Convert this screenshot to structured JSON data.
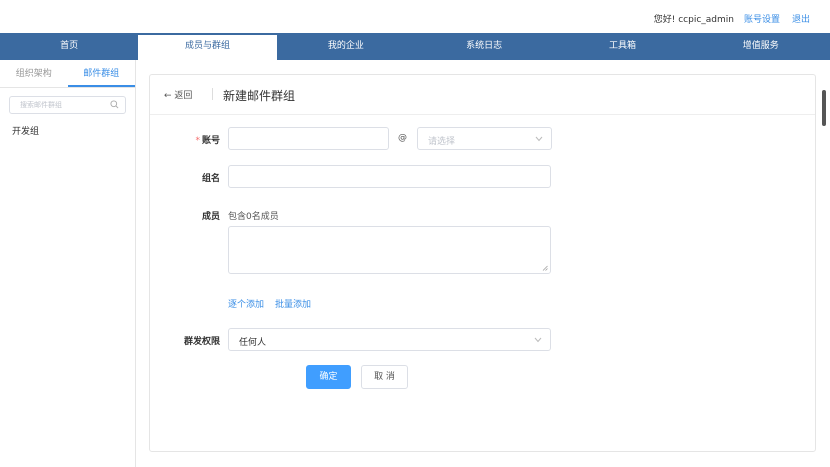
{
  "header": {
    "greeting": "您好! ccpic_admin",
    "account_settings": "账号设置",
    "logout": "退出"
  },
  "nav": {
    "items": [
      {
        "label": "首页"
      },
      {
        "label": "成员与群组"
      },
      {
        "label": "我的企业"
      },
      {
        "label": "系统日志"
      },
      {
        "label": "工具箱"
      },
      {
        "label": "增值服务"
      }
    ],
    "active_index": 1
  },
  "sidebar": {
    "tabs": [
      {
        "label": "组织架构"
      },
      {
        "label": "邮件群组"
      }
    ],
    "active_tab": 1,
    "search_placeholder": "搜索邮件群组",
    "groups": [
      {
        "label": "开发组"
      }
    ]
  },
  "form": {
    "back_label": "返回",
    "title": "新建邮件群组",
    "account_label": "账号",
    "at_symbol": "@",
    "domain_placeholder": "请选择",
    "group_name_label": "组名",
    "members_label": "成员",
    "members_count": "包含0名成员",
    "add_one": "逐个添加",
    "add_batch": "批量添加",
    "permission_label": "群发权限",
    "permission_value": "任何人",
    "confirm": "确定",
    "cancel": "取 消"
  },
  "colors": {
    "nav_bg": "#3b6aa0",
    "link": "#3a8ee6",
    "primary_button": "#409eff",
    "required": "#f56c6c"
  }
}
